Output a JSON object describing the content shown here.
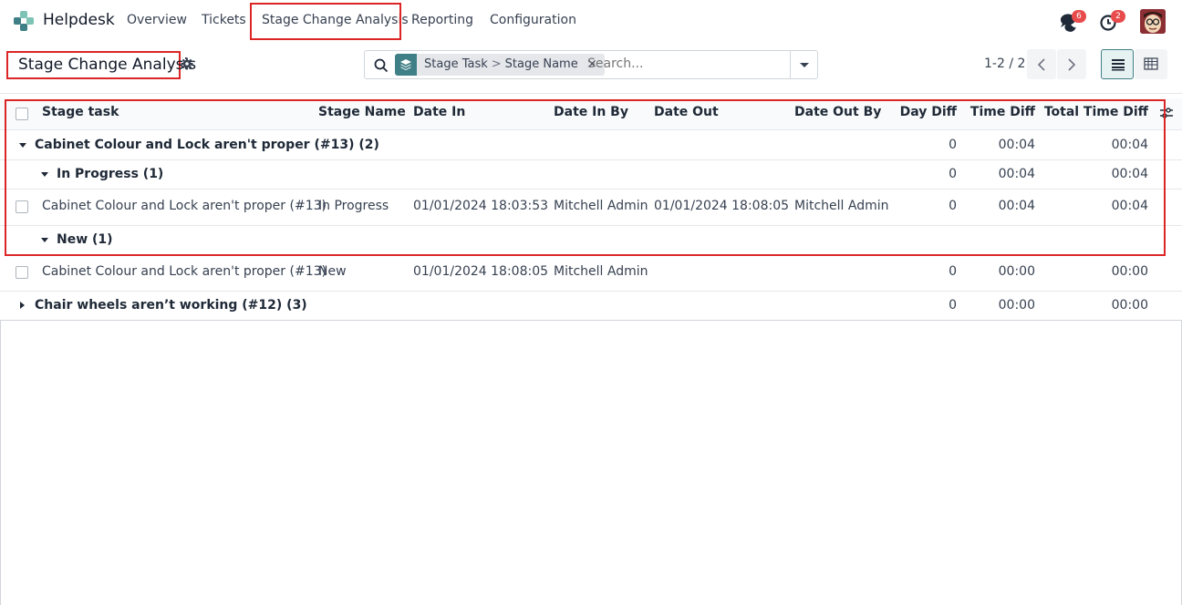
{
  "nav": {
    "app_name": "Helpdesk",
    "menu": [
      "Overview",
      "Tickets",
      "Stage Change Analysis",
      "Reporting",
      "Configuration"
    ],
    "messages_count": "6",
    "activities_count": "2"
  },
  "control_panel": {
    "title": "Stage Change Analysis",
    "facet": {
      "icon": "layers-icon",
      "part1": "Stage Task",
      "separator": ">",
      "part2": "Stage Name",
      "close": "×"
    },
    "search_placeholder": "Search...",
    "pager": "1-2 / 2"
  },
  "table": {
    "columns": [
      "Stage task",
      "Stage Name",
      "Date In",
      "Date In By",
      "Date Out",
      "Date Out By",
      "Day Diff",
      "Time Diff",
      "Total Time Diff"
    ],
    "rows": [
      {
        "kind": "group",
        "label": "Cabinet Colour and Lock aren't proper (#13) (2)",
        "day": "0",
        "time": "00:04",
        "total": "00:04"
      },
      {
        "kind": "subgroup",
        "label": "In Progress (1)",
        "day": "0",
        "time": "00:04",
        "total": "00:04"
      },
      {
        "kind": "record",
        "task": "Cabinet Colour and Lock aren't proper (#13)",
        "stage": "In Progress",
        "date_in": "01/01/2024 18:03:53",
        "date_in_by": "Mitchell Admin",
        "date_out": "01/01/2024 18:08:05",
        "date_out_by": "Mitchell Admin",
        "day": "0",
        "time": "00:04",
        "total": "00:04"
      },
      {
        "kind": "subgroup",
        "label": "New (1)",
        "day": "",
        "time": "",
        "total": ""
      },
      {
        "kind": "record",
        "task": "Cabinet Colour and Lock aren't proper (#13)",
        "stage": "New",
        "date_in": "01/01/2024 18:08:05",
        "date_in_by": "Mitchell Admin",
        "date_out": "",
        "date_out_by": "",
        "day": "0",
        "time": "00:00",
        "total": "00:00"
      },
      {
        "kind": "group_collapsed",
        "label": "Chair wheels aren’t working (#12) (3)",
        "day": "0",
        "time": "00:00",
        "total": "00:00"
      }
    ]
  }
}
